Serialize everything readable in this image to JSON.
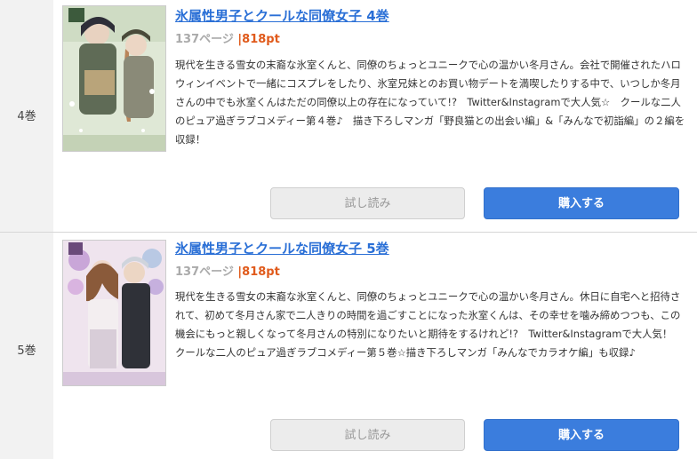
{
  "items": [
    {
      "volume": "4巻",
      "title": "氷属性男子とクールな同僚女子 4巻",
      "pages": "137ページ",
      "separator": "|",
      "price": "818pt",
      "description": "現代を生きる雪女の末裔な氷室くんと、同僚のちょっとユニークで心の温かい冬月さん。会社で開催されたハロウィンイベントで一緒にコスプレをしたり、氷室兄妹とのお買い物デートを満喫したりする中で、いつしか冬月さんの中でも氷室くんはただの同僚以上の存在になっていて!?　Twitter&Instagramで大人気☆　クールな二人のピュア過ぎラブコメディー第４巻♪　描き下ろしマンガ「野良猫との出会い編」&「みんなで初詣編」の２編を収録！",
      "trial_label": "試し読み",
      "buy_label": "購入する"
    },
    {
      "volume": "5巻",
      "title": "氷属性男子とクールな同僚女子 5巻",
      "pages": "137ページ",
      "separator": "|",
      "price": "818pt",
      "description": "現代を生きる雪女の末裔な氷室くんと、同僚のちょっとユニークで心の温かい冬月さん。休日に自宅へと招待されて、初めて冬月さん家で二人きりの時間を過ごすことになった氷室くんは、その幸せを噛み締めつつも、この機会にもっと親しくなって冬月さんの特別になりたいと期待をするけれど!?　Twitter&Instagramで大人気！　クールな二人のピュア過ぎラブコメディー第５巻☆描き下ろしマンガ「みんなでカラオケ編」も収録♪",
      "trial_label": "試し読み",
      "buy_label": "購入する"
    }
  ],
  "colors": {
    "title_link": "#2a6fd6",
    "price": "#e05a1b",
    "buy_button": "#3b7ddd",
    "trial_button": "#ececec",
    "volume_column": "#f2f2f2"
  }
}
